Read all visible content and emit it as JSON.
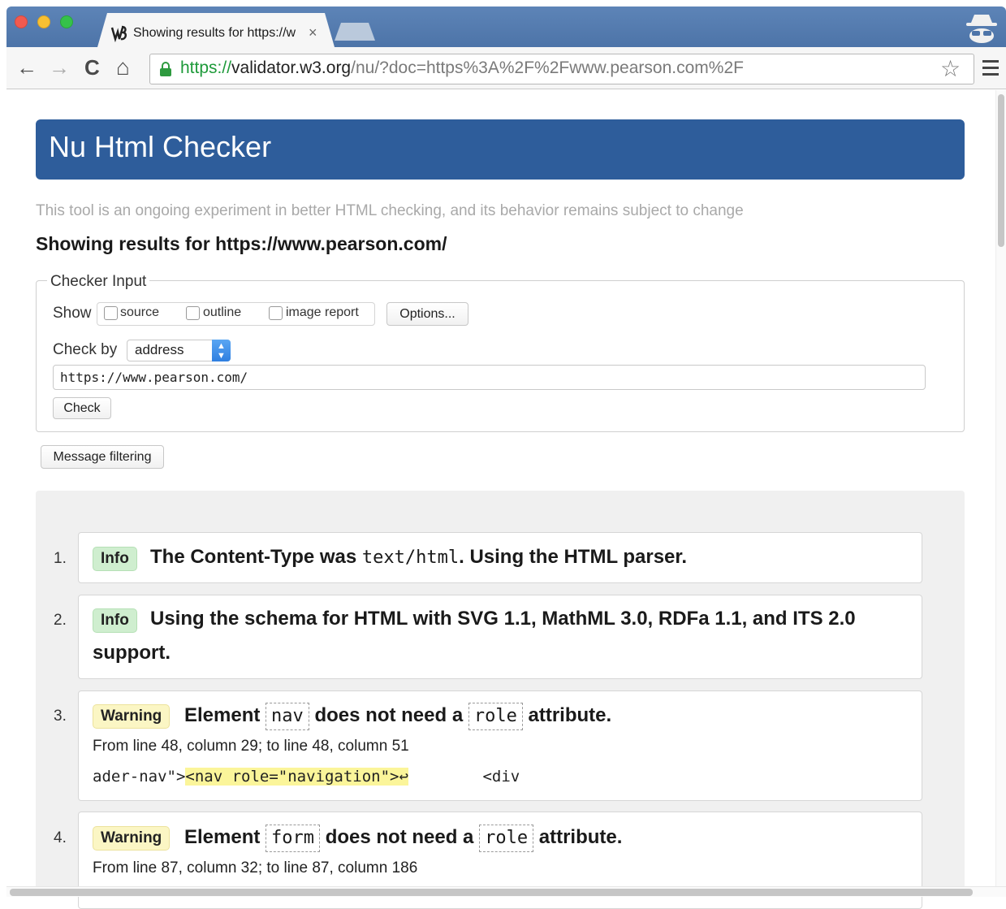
{
  "browser": {
    "tab_title": "Showing results for https://w",
    "tab_close": "×",
    "url_scheme": "https://",
    "url_host": "validator.w3.org",
    "url_path": "/nu/?doc=https%3A%2F%2Fwww.pearson.com%2F",
    "icons": {
      "back": "←",
      "forward": "→",
      "reload": "C",
      "home": "⌂",
      "star": "☆"
    }
  },
  "page": {
    "banner_title": "Nu Html Checker",
    "tagline": "This tool is an ongoing experiment in better HTML checking, and its behavior remains subject to change",
    "results_heading": "Showing results for https://www.pearson.com/",
    "checker_input": {
      "legend": "Checker Input",
      "show_label": "Show",
      "show_options": [
        "source",
        "outline",
        "image report"
      ],
      "options_button": "Options...",
      "check_by_label": "Check by",
      "check_by_value": "address",
      "url_value": "https://www.pearson.com/",
      "check_button": "Check"
    },
    "message_filtering_button": "Message filtering",
    "messages": [
      {
        "num": "1.",
        "type": "Info",
        "text_parts": [
          "The Content-Type was ",
          "text/html",
          ". Using the HTML parser."
        ]
      },
      {
        "num": "2.",
        "type": "Info",
        "line1": "Using the schema for HTML with SVG 1.1, MathML 3.0, RDFa 1.1, and ITS 2.0",
        "line2": "support."
      },
      {
        "num": "3.",
        "type": "Warning",
        "text_parts": [
          "Element",
          "nav",
          "does not need a",
          "role",
          "attribute."
        ],
        "location": "From line 48, column 29; to line 48, column 51",
        "extract_before": "ader-nav\">",
        "extract_highlight": "<nav role=\"navigation\">↩",
        "extract_after": "        <div"
      },
      {
        "num": "4.",
        "type": "Warning",
        "text_parts": [
          "Element",
          "form",
          "does not need a",
          "role",
          "attribute."
        ],
        "location": "From line 87, column 32; to line 87, column 186"
      }
    ]
  }
}
